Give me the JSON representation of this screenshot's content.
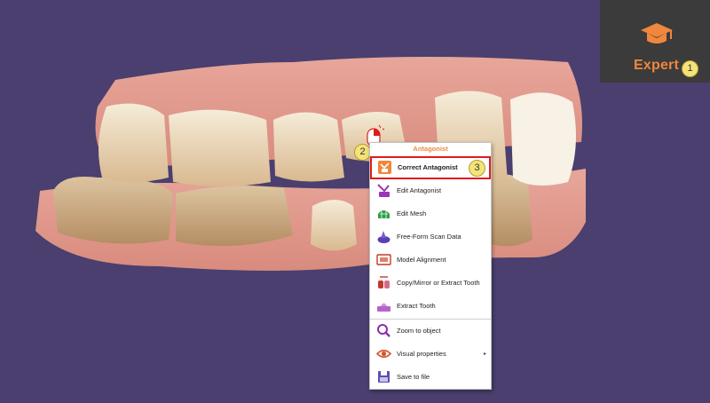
{
  "expert": {
    "label": "Expert",
    "callout": "1"
  },
  "menu": {
    "header": "Antagonist",
    "items": [
      {
        "label": "Correct Antagonist",
        "icon": "correct-antagonist-icon"
      },
      {
        "label": "Edit Antagonist",
        "icon": "edit-antagonist-icon"
      },
      {
        "label": "Edit Mesh",
        "icon": "edit-mesh-icon"
      },
      {
        "label": "Free-Form Scan Data",
        "icon": "free-form-icon"
      },
      {
        "label": "Model Alignment",
        "icon": "model-alignment-icon"
      },
      {
        "label": "Copy/Mirror or Extract Tooth",
        "icon": "copy-mirror-icon"
      },
      {
        "label": "Extract Tooth",
        "icon": "extract-tooth-icon"
      },
      {
        "label": "Zoom to object",
        "icon": "zoom-icon"
      },
      {
        "label": "Visual properties",
        "icon": "eye-icon"
      },
      {
        "label": "Save to file",
        "icon": "save-icon"
      }
    ],
    "submenu_arrow": "▸"
  },
  "callouts": {
    "mouse": "2",
    "selected_item": "3"
  },
  "colors": {
    "accent": "#f0873c",
    "highlight": "#e01b1b",
    "background": "#4a3f6e"
  }
}
